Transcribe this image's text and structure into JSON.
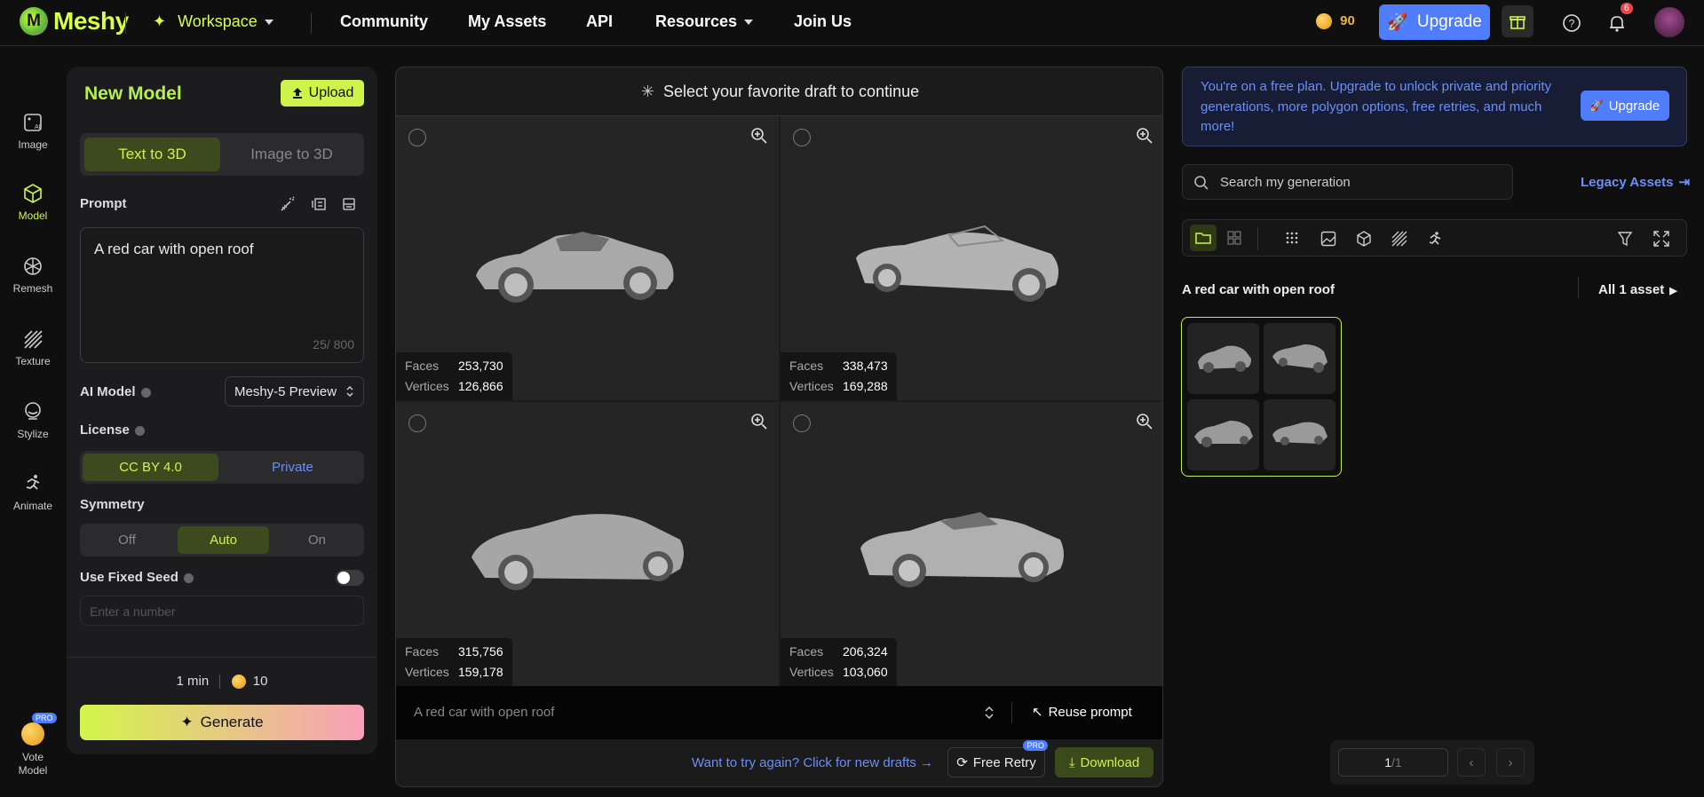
{
  "header": {
    "brand": "Meshy",
    "nav": {
      "workspace": "Workspace",
      "community": "Community",
      "my_assets": "My Assets",
      "api": "API",
      "resources": "Resources",
      "join_us": "Join Us"
    },
    "credits": "90",
    "upgrade_label": "Upgrade",
    "notification_count": "6"
  },
  "rail": {
    "items": [
      {
        "label": "Image"
      },
      {
        "label": "Model"
      },
      {
        "label": "Remesh"
      },
      {
        "label": "Texture"
      },
      {
        "label": "Stylize"
      },
      {
        "label": "Animate"
      }
    ],
    "vote_label": "Vote Model",
    "pro_badge": "PRO"
  },
  "left_panel": {
    "title": "New Model",
    "upload_label": "Upload",
    "tabs": [
      "Text to 3D",
      "Image to 3D"
    ],
    "prompt_label": "Prompt",
    "prompt_value": "A red car with open roof",
    "char_count": "25/ 800",
    "ai_model_label": "AI Model",
    "ai_model_value": "Meshy-5 Preview",
    "license_label": "License",
    "license_options": [
      "CC BY 4.0",
      "Private"
    ],
    "symmetry_label": "Symmetry",
    "symmetry_options": [
      "Off",
      "Auto",
      "On"
    ],
    "seed_label": "Use Fixed Seed",
    "seed_placeholder": "Enter a number",
    "eta": "1 min",
    "cost": "10",
    "generate_label": "Generate"
  },
  "drafts": {
    "heading": "Select your favorite draft to continue",
    "faces_label": "Faces",
    "vertices_label": "Vertices",
    "items": [
      {
        "faces": "253,730",
        "vertices": "126,866"
      },
      {
        "faces": "338,473",
        "vertices": "169,288"
      },
      {
        "faces": "315,756",
        "vertices": "159,178"
      },
      {
        "faces": "206,324",
        "vertices": "103,060"
      }
    ],
    "prompt_bar": "A red car with open roof",
    "reuse_label": "Reuse prompt",
    "retry_link": "Want to try again? Click for new drafts →",
    "free_retry_label": "Free Retry",
    "pro_badge": "PRO",
    "download_label": "Download"
  },
  "right_panel": {
    "banner_text": "You're on a free plan. Upgrade to unlock private and priority generations, more polygon options, free retries, and much more!",
    "banner_button": "Upgrade",
    "search_placeholder": "Search my generation",
    "legacy_label": "Legacy Assets",
    "group_title": "A red car with open roof",
    "all_assets": "All 1 asset",
    "page_value": "1",
    "page_total": "/1"
  },
  "colors": {
    "accent": "#cef44c",
    "blue": "#4f7dfb"
  }
}
